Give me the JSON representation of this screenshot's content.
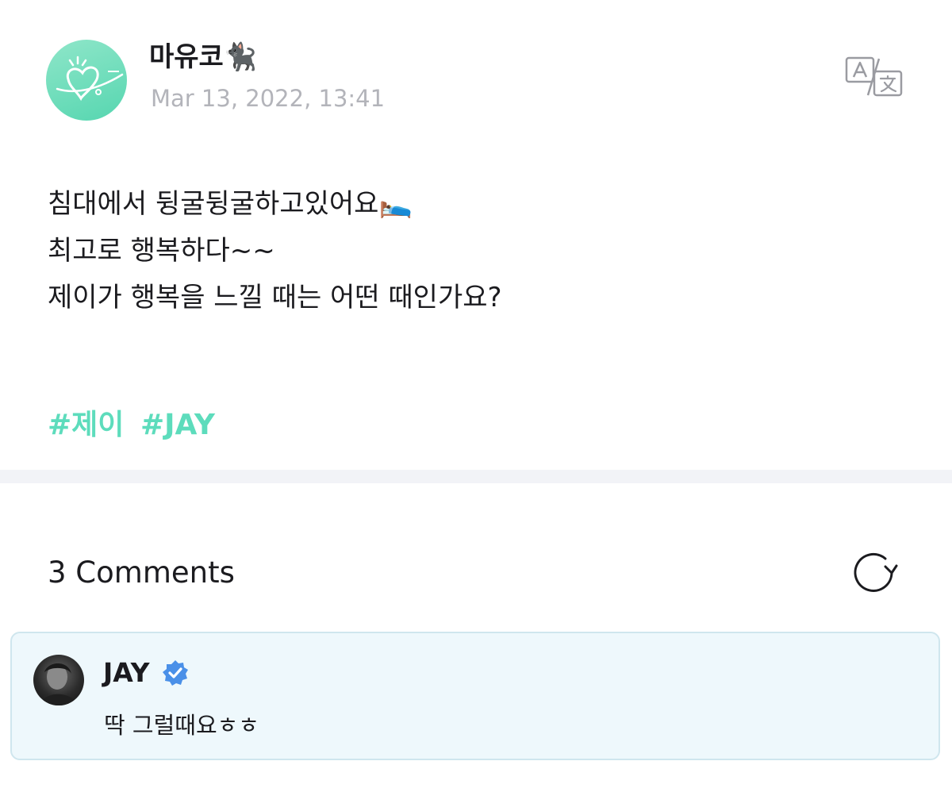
{
  "post": {
    "author": {
      "name": "마유코🐈‍⬛",
      "date": "Mar 13, 2022, 13:41"
    },
    "translate_icon": "translate-icon",
    "body_lines": [
      "침대에서 뒹굴뒹굴하고있어요🛌",
      "최고로 행복하다~~",
      "제이가 행복을 느낄 때는 어떤 때인가요?"
    ],
    "hashtags": [
      "#제이",
      "#JAY"
    ]
  },
  "comments": {
    "title": "3 Comments",
    "refresh_icon": "refresh-icon",
    "items": [
      {
        "author": "JAY",
        "verified": true,
        "text": "딱 그럴때요ㅎㅎ"
      }
    ]
  },
  "colors": {
    "accent": "#5ddcbc",
    "date": "#b3b4ba",
    "comment_bg": "#eef8fc",
    "comment_border": "#cfe6ee",
    "verified": "#4a90e8"
  }
}
